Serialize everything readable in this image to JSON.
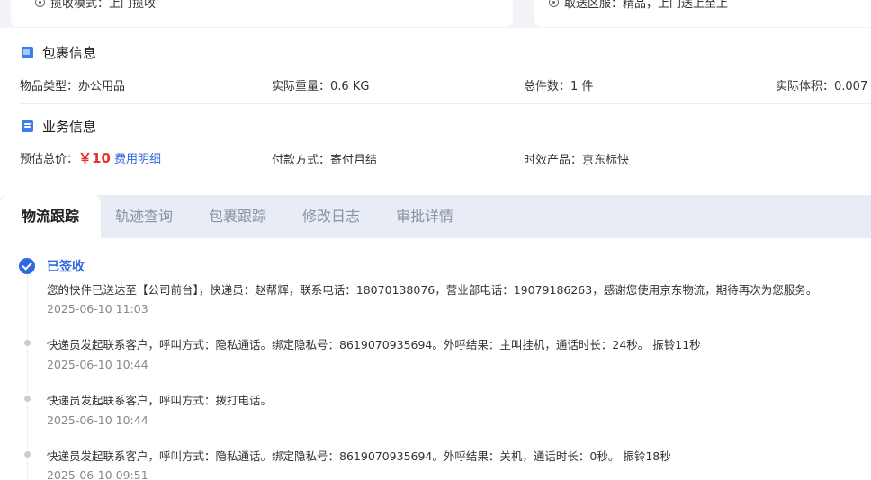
{
  "top": {
    "left_text": "揽收模式：上门揽收",
    "right_text": "取送区服：精品，上门送上至上"
  },
  "package_info": {
    "title": "包裹信息",
    "item_type": "物品类型：办公用品",
    "actual_weight": "实际重量：0.6 KG",
    "total_pieces": "总件数：1 件",
    "actual_volume": "实际体积：0.007"
  },
  "business_info": {
    "title": "业务信息",
    "estimated_total_label": "预估总价：",
    "estimated_total_value": "￥10",
    "fee_detail_link": "费用明细",
    "payment_method": "付款方式：寄付月结",
    "product": "时效产品：京东标快"
  },
  "tabs": [
    {
      "label": "物流跟踪",
      "active": true
    },
    {
      "label": "轨迹查询",
      "active": false
    },
    {
      "label": "包裹跟踪",
      "active": false
    },
    {
      "label": "修改日志",
      "active": false
    },
    {
      "label": "审批详情",
      "active": false
    }
  ],
  "timeline": [
    {
      "status": "已签收",
      "text": "您的快件已送达至【公司前台】，快递员：赵帮辉，联系电话：18070138076，营业部电话：19079186263，感谢您使用京东物流，期待再次为您服务。",
      "time": "2025-06-10 11:03"
    },
    {
      "text": "快递员发起联系客户，呼叫方式：隐私通话。绑定隐私号：8619070935694。外呼结果：主叫挂机，通话时长：24秒。 振铃11秒",
      "time": "2025-06-10 10:44"
    },
    {
      "text": "快递员发起联系客户，呼叫方式：拨打电话。",
      "time": "2025-06-10 10:44"
    },
    {
      "text": "快递员发起联系客户，呼叫方式：隐私通话。绑定隐私号：8619070935694。外呼结果：关机，通话时长：0秒。 振铃18秒",
      "time": "2025-06-10 09:51"
    }
  ],
  "colors": {
    "accent": "#2e69e0",
    "price": "#e5322d"
  }
}
